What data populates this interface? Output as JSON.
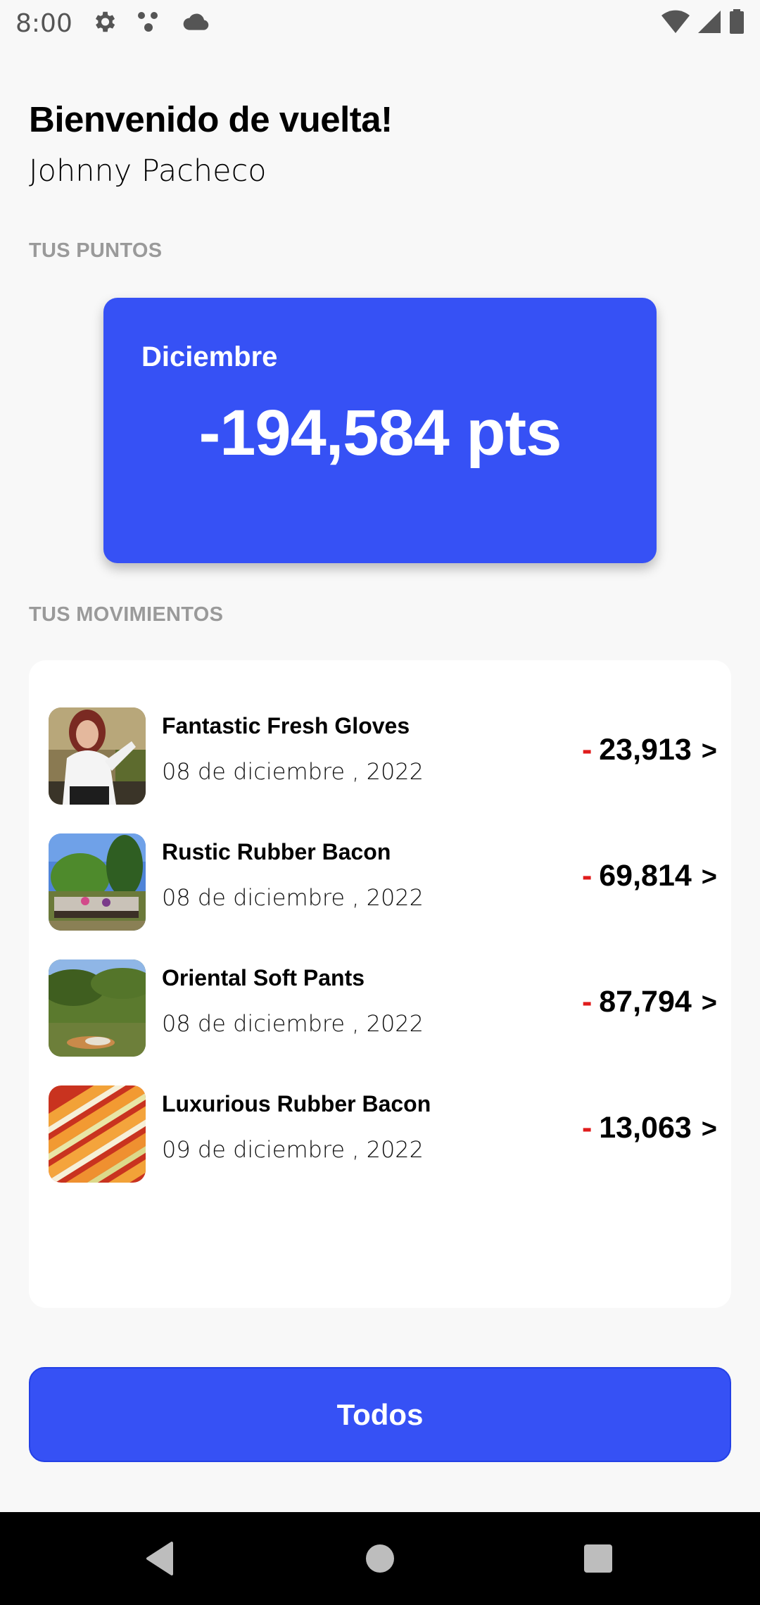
{
  "status_bar": {
    "time": "8:00",
    "icons": [
      "gear-icon",
      "dots-icon",
      "cloud-icon",
      "wifi-icon",
      "signal-icon",
      "battery-icon"
    ]
  },
  "header": {
    "welcome": "Bienvenido de vuelta!",
    "user_name": "Johnny Pacheco"
  },
  "points": {
    "section_label": "TUS PUNTOS",
    "month": "Diciembre",
    "value": "-194,584 pts"
  },
  "movements": {
    "section_label": "TUS MOVIMIENTOS",
    "items": [
      {
        "title": "Fantastic Fresh Gloves",
        "date": "08 de diciembre , 2022",
        "sign": "-",
        "amount": "23,913",
        "chevron": ">"
      },
      {
        "title": "Rustic Rubber Bacon",
        "date": "08 de diciembre , 2022",
        "sign": "-",
        "amount": "69,814",
        "chevron": ">"
      },
      {
        "title": "Oriental Soft Pants",
        "date": "08 de diciembre , 2022",
        "sign": "-",
        "amount": "87,794",
        "chevron": ">"
      },
      {
        "title": "Luxurious Rubber Bacon",
        "date": "09 de diciembre , 2022",
        "sign": "-",
        "amount": "13,063",
        "chevron": ">"
      }
    ]
  },
  "button": {
    "label": "Todos"
  },
  "colors": {
    "accent": "#3651f5",
    "negative": "#e01c1c",
    "background": "#f8f8f8"
  }
}
